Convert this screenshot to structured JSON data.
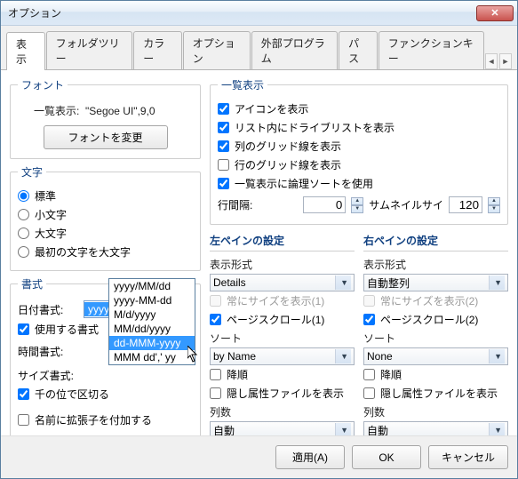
{
  "window": {
    "title": "オプション"
  },
  "tabs": [
    "表示",
    "フォルダツリー",
    "カラー",
    "オプション",
    "外部プログラム",
    "パス",
    "ファンクションキー"
  ],
  "activeTab": 0,
  "font": {
    "legend": "フォント",
    "label": "一覧表示:",
    "value": "\"Segoe UI\",9,0",
    "button": "フォントを変更"
  },
  "moji": {
    "legend": "文字",
    "options": [
      "標準",
      "小文字",
      "大文字",
      "最初の文字を大文字"
    ],
    "selected": 0
  },
  "listDisp": {
    "legend": "一覧表示",
    "items": [
      {
        "label": "アイコンを表示",
        "checked": true
      },
      {
        "label": "リスト内にドライブリストを表示",
        "checked": true
      },
      {
        "label": "列のグリッド線を表示",
        "checked": true
      },
      {
        "label": "行のグリッド線を表示",
        "checked": false
      },
      {
        "label": "一覧表示に論理ソートを使用",
        "checked": true
      }
    ],
    "lineHeightLabel": "行間隔:",
    "lineHeight": "0",
    "thumbLabel": "サムネイルサイ",
    "thumbVal": "120"
  },
  "panes": {
    "leftTitle": "左ペインの設定",
    "rightTitle": "右ペインの設定",
    "dispLabel": "表示形式",
    "leftDisp": "Details",
    "rightDisp": "自動整列",
    "alwaysSize1": "常にサイズを表示(1)",
    "alwaysSize2": "常にサイズを表示(2)",
    "pageScroll1": "ページスクロール(1)",
    "pageScroll2": "ページスクロール(2)",
    "sortLabel": "ソート",
    "leftSort": "by Name",
    "rightSort": "None",
    "descLabel": "降順",
    "hiddenLabel": "隠し属性ファイルを表示",
    "colsLabel": "列数",
    "colsVal": "自動"
  },
  "format": {
    "legend": "書式",
    "dateLabel": "日付書式:",
    "dateVal": "yyyy-MM-dd",
    "useFmt": "使用する書式",
    "timeLabel": "時間書式:",
    "sizeLabel": "サイズ書式:",
    "thousands": "千の位で区切る",
    "nameExt": "名前に拡張子を付加する",
    "dropdown": [
      "yyyy/MM/dd",
      "yyyy-MM-dd",
      "M/d/yyyy",
      "MM/dd/yyyy",
      "dd-MMM-yyyy",
      "MMM dd',' yy"
    ],
    "ddSel": 4
  },
  "buttons": {
    "apply": "適用(A)",
    "ok": "OK",
    "cancel": "キャンセル"
  }
}
